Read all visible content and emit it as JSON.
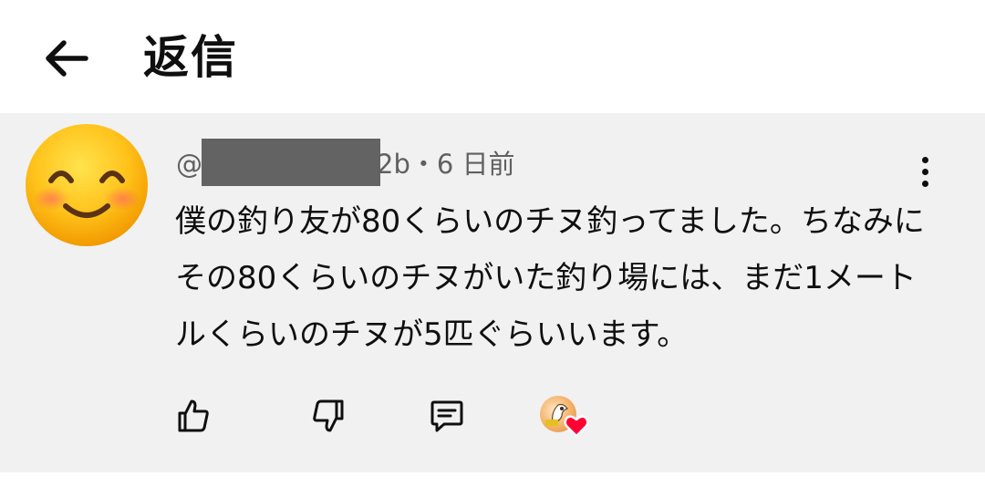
{
  "header": {
    "back_icon": "arrow-left-icon",
    "title": "返信"
  },
  "comment": {
    "avatar_icon": "smiling-face-emoji",
    "handle_prefix": "@",
    "handle_suffix": "2b",
    "time_ago": "・6 日前",
    "text": "僕の釣り友が80くらいのチヌ釣ってました。ちなみにその80くらいのチヌがいた釣り場には、まだ1メートルくらいのチヌが5匹ぐらいいます。",
    "actions": {
      "like_icon": "thumbs-up-icon",
      "dislike_icon": "thumbs-down-icon",
      "reply_icon": "comment-icon",
      "creator_heart_icon": "creator-heart-icon"
    },
    "more_icon": "more-vertical-icon"
  },
  "colors": {
    "comment_bg": "#f1f1f1",
    "meta_text": "#606060",
    "heart": "#ff0033"
  }
}
